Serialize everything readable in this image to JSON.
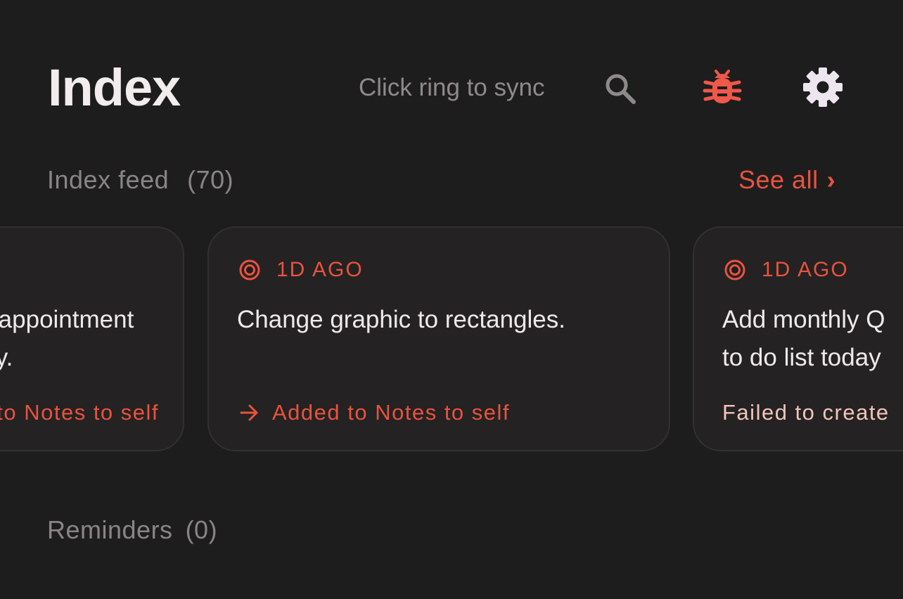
{
  "header": {
    "title": "Index",
    "sync_hint": "Click ring to sync",
    "icons": {
      "search": "search-icon",
      "bug": "bug-icon",
      "settings": "gear-icon"
    },
    "bug_color": "#f0584a",
    "gear_color": "#ede6ee"
  },
  "feed": {
    "label": "Index feed",
    "count": "(70)",
    "see_all": "See all",
    "see_all_chevron": "›",
    "accent_color": "#e8533f",
    "cards": [
      {
        "body_line_1": "Schedule appointment",
        "body_line_2": "for Sunday.",
        "footer": "Added to Notes to self",
        "status": "success"
      },
      {
        "timestamp": "1D AGO",
        "body_line_1": "Change graphic to rectangles.",
        "body_line_2": "",
        "footer": "Added to Notes to self",
        "status": "success"
      },
      {
        "timestamp": "1D AGO",
        "body_line_1": "Add monthly Q",
        "body_line_2": "to do list today",
        "footer": "Failed to create",
        "status": "failed"
      }
    ]
  },
  "reminders": {
    "label": "Reminders",
    "count": "(0)"
  }
}
